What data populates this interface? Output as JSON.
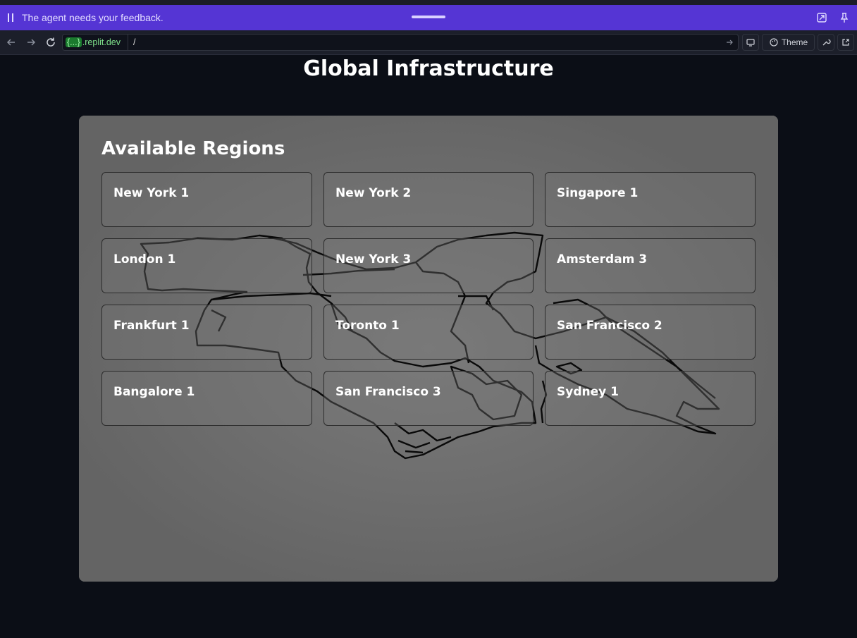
{
  "feedback_bar": {
    "message": "The agent needs your feedback.",
    "color": "#5535d4"
  },
  "address_bar": {
    "host_chip": "{...}",
    "host_domain": ".replit.dev",
    "path": "/",
    "theme_label": "Theme"
  },
  "page": {
    "title": "Global Infrastructure",
    "section_title": "Available Regions",
    "regions": [
      {
        "name": "New York 1"
      },
      {
        "name": "New York 2"
      },
      {
        "name": "Singapore 1"
      },
      {
        "name": "London 1"
      },
      {
        "name": "New York 3"
      },
      {
        "name": "Amsterdam 3"
      },
      {
        "name": "Frankfurt 1"
      },
      {
        "name": "Toronto 1"
      },
      {
        "name": "San Francisco 2"
      },
      {
        "name": "Bangalore 1"
      },
      {
        "name": "San Francisco 3"
      },
      {
        "name": "Sydney 1"
      }
    ]
  },
  "colors": {
    "background": "#0b0e16",
    "panel": "#656565",
    "accent_green": "#7ee08a"
  },
  "icons": [
    "pause-icon",
    "drag-handle-icon",
    "expand-icon",
    "pin-icon",
    "back-icon",
    "forward-icon",
    "reload-icon",
    "go-icon",
    "devices-icon",
    "palette-icon",
    "wrench-icon",
    "external-link-icon"
  ]
}
